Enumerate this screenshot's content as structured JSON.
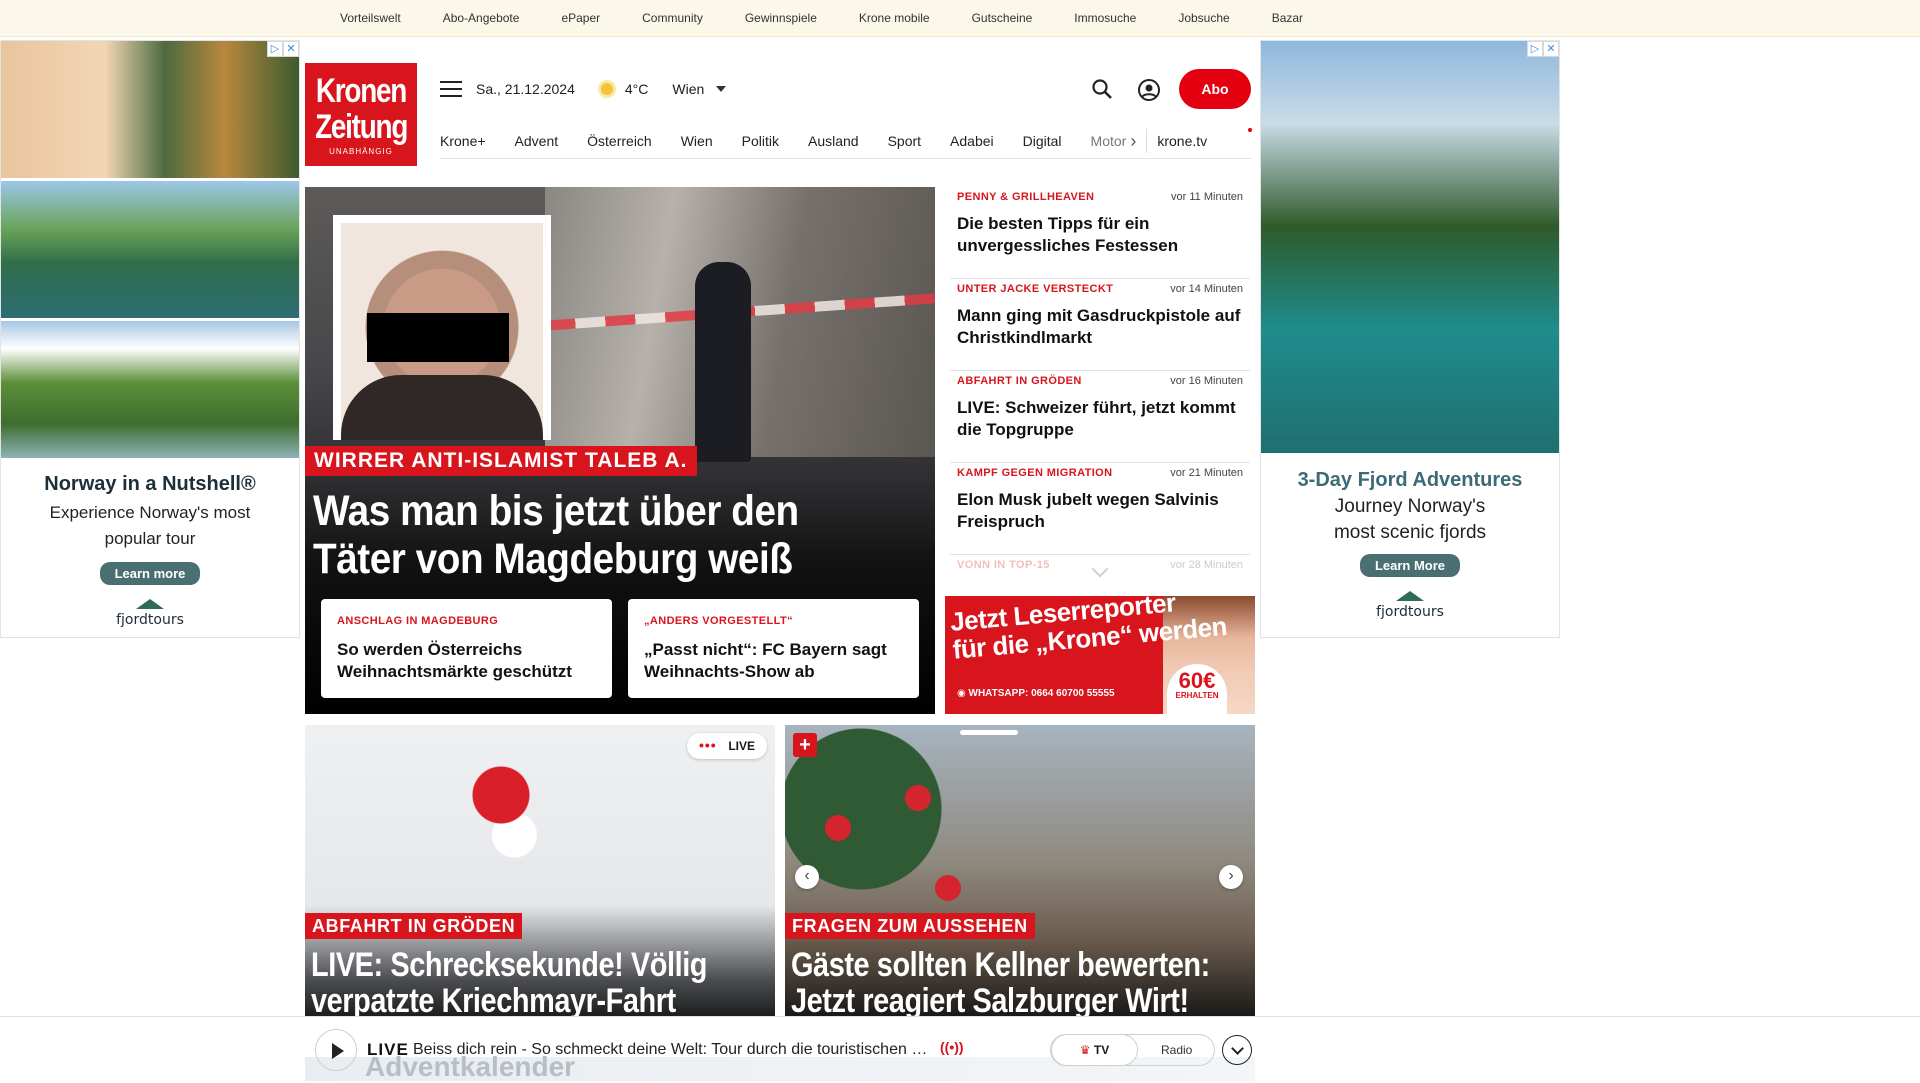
{
  "topbar": {
    "links": [
      "Vorteilswelt",
      "Abo-Angebote",
      "ePaper",
      "Community",
      "Gewinnspiele",
      "Krone mobile",
      "Gutscheine",
      "Immosuche",
      "Jobsuche",
      "Bazar"
    ]
  },
  "ad_left": {
    "title": "Norway in a Nutshell®",
    "subtitle_line1": "Experience Norway's most",
    "subtitle_line2": "popular tour",
    "button": "Learn more",
    "brand": "fjordtours"
  },
  "ad_right": {
    "title": "3-Day Fjord Adventures",
    "subtitle_line1": "Journey Norway's",
    "subtitle_line2": "most scenic fjords",
    "button": "Learn More",
    "brand": "fjordtours"
  },
  "header": {
    "logo_line1": "Kronen",
    "logo_line2": "Zeitung",
    "logo_tagline": "UNABHÄNGIG",
    "date": "Sa., 21.12.2024",
    "temperature": "4°C",
    "city": "Wien",
    "abo_button": "Abo",
    "nav": [
      "Krone+",
      "Advent",
      "Österreich",
      "Wien",
      "Politik",
      "Ausland",
      "Sport",
      "Adabei",
      "Digital"
    ],
    "nav_faded": "Motor",
    "nav_tv": "krone.tv"
  },
  "hero": {
    "label": "WIRRER ANTI-ISLAMIST TALEB A.",
    "title_line1": "Was man bis jetzt über den",
    "title_line2": "Täter von Magdeburg weiß",
    "subcards": [
      {
        "kicker": "ANSCHLAG IN MAGDEBURG",
        "title": "So werden Österreichs Weihnachtsmärkte geschützt"
      },
      {
        "kicker": "„ANDERS VORGESTELLT“",
        "title": "„Passt nicht“: FC Bayern sagt Weihnachts-Show ab"
      }
    ]
  },
  "ticker": [
    {
      "kicker": "PENNY & GRILLHEAVEN",
      "time": "vor 11 Minuten",
      "title": "Die besten Tipps für ein unvergessliches Festessen"
    },
    {
      "kicker": "UNTER JACKE VERSTECKT",
      "time": "vor 14 Minuten",
      "title": "Mann ging mit Gasdruckpistole auf Christkindlmarkt"
    },
    {
      "kicker": "ABFAHRT IN GRÖDEN",
      "time": "vor 16 Minuten",
      "title": "LIVE: Schweizer führt, jetzt kommt die Topgruppe"
    },
    {
      "kicker": "KAMPF GEGEN MIGRATION",
      "time": "vor 21 Minuten",
      "title": "Elon Musk jubelt wegen Salvinis Freispruch"
    },
    {
      "kicker": "VONN IN TOP-15",
      "time": "vor 28 Minuten",
      "title": ""
    }
  ],
  "reporter_ad": {
    "headline_line1": "Jetzt Leserreporter",
    "headline_line2": "für die „Krone“ werden",
    "whatsapp": "WHATSAPP: 0664 60700 55555",
    "amount": "60€",
    "amount_sub": "ERHALTEN"
  },
  "cards": [
    {
      "label": "ABFAHRT IN GRÖDEN",
      "title_line1": "LIVE: Schrecksekunde! Völlig",
      "title_line2": "verpatzte Kriechmayr-Fahrt",
      "badge": "LIVE"
    },
    {
      "label": "FRAGEN ZUM AUSSEHEN",
      "title_line1": "Gäste sollten Kellner bewerten:",
      "title_line2": "Jetzt reagiert Salzburger Wirt!",
      "badge": "+"
    }
  ],
  "player": {
    "live": "LIVE",
    "text": "Beiss dich rein - So schmeckt deine Welt: Tour durch die touristischen Hi...",
    "tv": "TV",
    "radio": "Radio",
    "background_text": "Adventkalender"
  },
  "colors": {
    "brand_red": "#d8141c",
    "topbar_bg": "#fbf7e9"
  }
}
